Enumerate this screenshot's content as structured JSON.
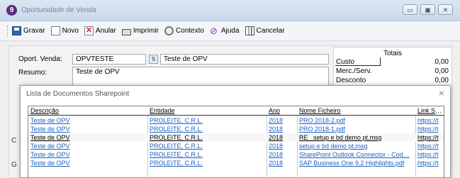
{
  "window": {
    "title": "Oportunidade de Venda",
    "app_icon": "9",
    "buttons": [
      "minimize-icon",
      "maximize-icon",
      "close-icon"
    ]
  },
  "toolbar": {
    "gravar": "Gravar",
    "novo": "Novo",
    "anular": "Anular",
    "imprimir": "Imprimir",
    "contexto": "Contexto",
    "ajuda": "Ajuda",
    "cancelar": "Cancelar"
  },
  "form": {
    "oport_label": "Oport. Venda:",
    "oport_code": "OPVTESTE",
    "oport_desc": "Teste de OPV",
    "resumo_label": "Resumo:",
    "resumo_value": "Teste de OPV"
  },
  "totais": {
    "title": "Totais",
    "rows": [
      {
        "label": "Custo",
        "value": "0,00"
      },
      {
        "label": "Merc./Serv.",
        "value": "0,00"
      },
      {
        "label": "Desconto",
        "value": "0,00"
      }
    ]
  },
  "dialog": {
    "title": "Lista de Documentos Sharepoint",
    "close": "×",
    "columns": [
      "Descrição",
      "Entidade",
      "Ano",
      "Nome Ficheiro",
      "Link Shar"
    ],
    "rows": [
      [
        "Teste de OPV",
        "PROLEITE, C.R.L.",
        "2018",
        "PRO 2018-2.pdf",
        "https://t"
      ],
      [
        "Teste de OPV",
        "PROLEITE, C.R.L.",
        "2018",
        "PRO 2018-1.pdf",
        "https://t"
      ],
      [
        "Teste de OPV",
        "PROLEITE, C.R.L.",
        "2018",
        "RE_ setup e bd demo pt.msg",
        "https://t"
      ],
      [
        "Teste de OPV",
        "PROLEITE, C.R.L.",
        "2018",
        "setup e bd demo pt.msg",
        "https://t"
      ],
      [
        "Teste de OPV",
        "PROLEITE, C.R.L.",
        "2018",
        "SharePoint Outlook Connector - Cod…",
        "https://t"
      ],
      [
        "Teste de OPV",
        "PROLEITE, C.R.L.",
        "2018",
        "SAP Business One 9.2 Highlights.pdf",
        "https://t"
      ]
    ]
  },
  "side_labels": {
    "c": "C",
    "g": "G"
  }
}
